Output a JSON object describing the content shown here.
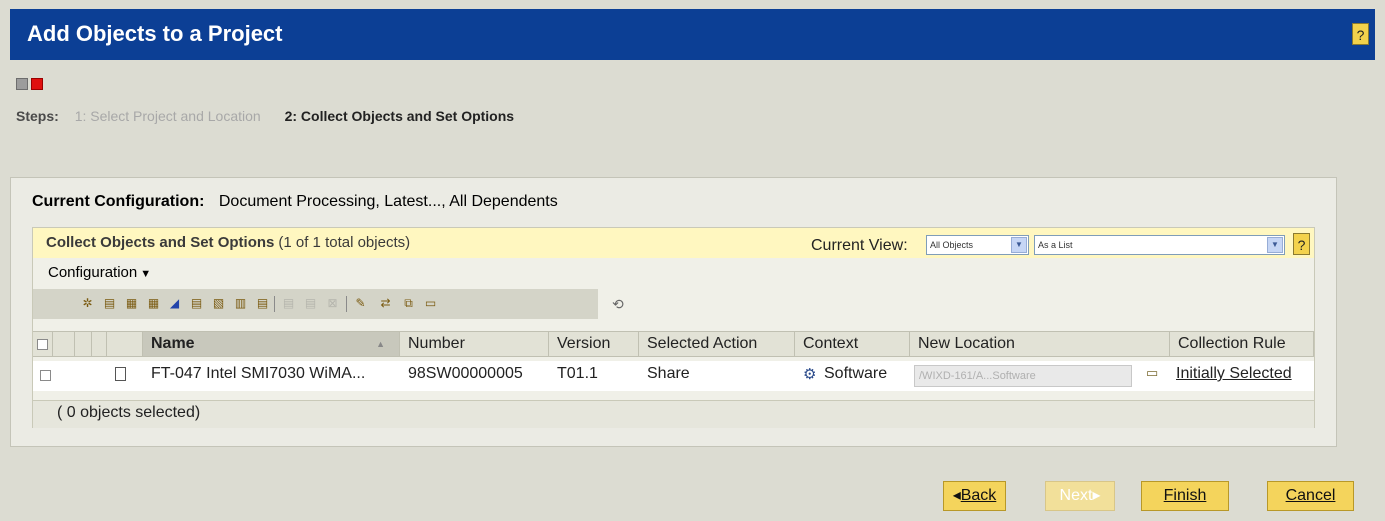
{
  "window": {
    "title": "Add Objects to a Project",
    "help_label": "?"
  },
  "steps": {
    "label": "Steps:",
    "items": [
      "1: Select Project and Location",
      "2: Collect Objects and Set Options"
    ],
    "colors": {
      "done": "#9c9c9c",
      "current": "#e0100e"
    }
  },
  "current_configuration": {
    "label": "Current Configuration:",
    "value": "Document Processing, Latest..., All Dependents"
  },
  "collect": {
    "title": "Collect Objects and Set Options",
    "count": "(1 of 1 total objects)",
    "current_view_label": "Current View:",
    "view_filter": "All Objects",
    "view_mode": "As a List",
    "help_label": "?"
  },
  "configuration_menu": {
    "label": "Configuration"
  },
  "table": {
    "columns": [
      "Name",
      "Number",
      "Version",
      "Selected Action",
      "Context",
      "New Location",
      "Collection Rule"
    ],
    "rows": [
      {
        "name": "FT-047 Intel SMI7030 WiMA...",
        "number": "98SW00000005",
        "version": "T01.1",
        "selected_action": "Share",
        "context": "Software",
        "new_location": "/WIXD-161/A...Software",
        "collection_rule": "Initially Selected"
      }
    ],
    "selection_status": "( 0 objects selected)"
  },
  "buttons": {
    "back": "Back",
    "next": "Next",
    "finish": "Finish",
    "cancel": "Cancel"
  },
  "colors": {
    "title_bar": "#0c3f95",
    "accent_button": "#f4d45c",
    "header_band": "#fff7c0"
  }
}
